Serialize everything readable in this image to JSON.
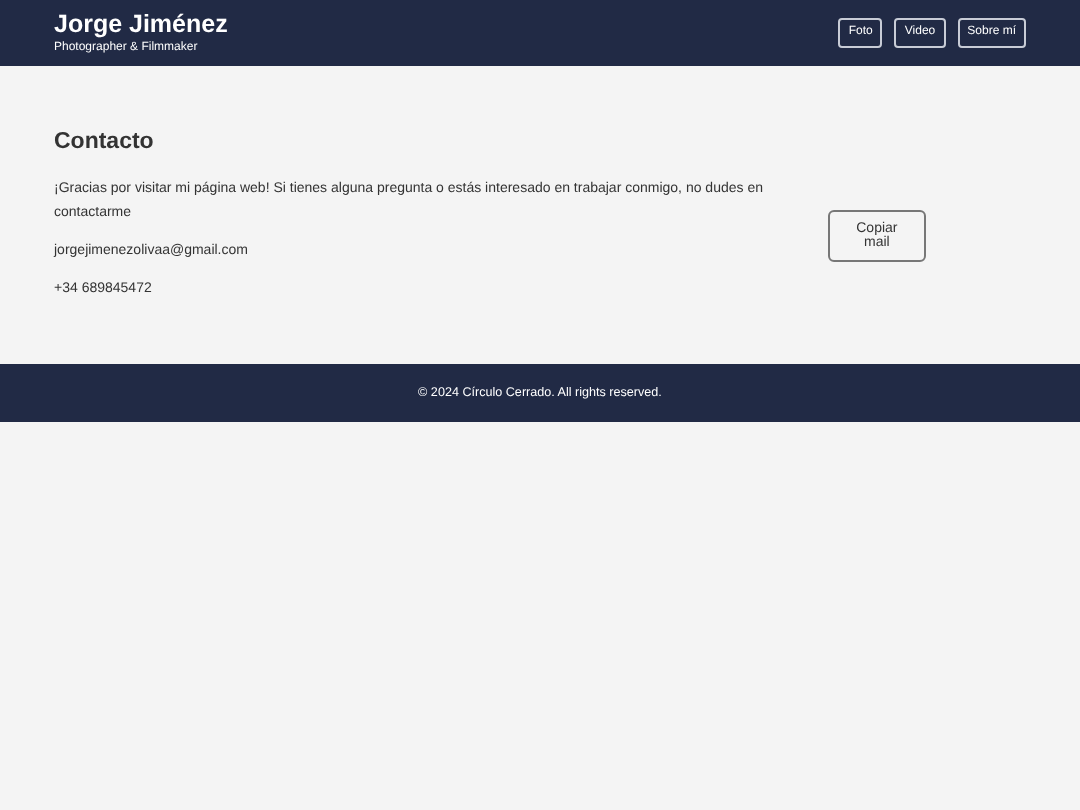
{
  "header": {
    "title": "Jorge Jiménez",
    "subtitle": "Photographer & Filmmaker",
    "nav": [
      "Foto",
      "Video",
      "Sobre mí"
    ]
  },
  "contact": {
    "heading": "Contacto",
    "intro": "¡Gracias por visitar mi página web! Si tienes alguna pregunta o estás interesado en trabajar conmigo, no dudes en contactarme",
    "email": "jorgejimenezolivaa@gmail.com",
    "phone": "+34 689845472",
    "button": "Copiar mail"
  },
  "footer": {
    "text": "© 2024 Círculo Cerrado. All rights reserved."
  }
}
